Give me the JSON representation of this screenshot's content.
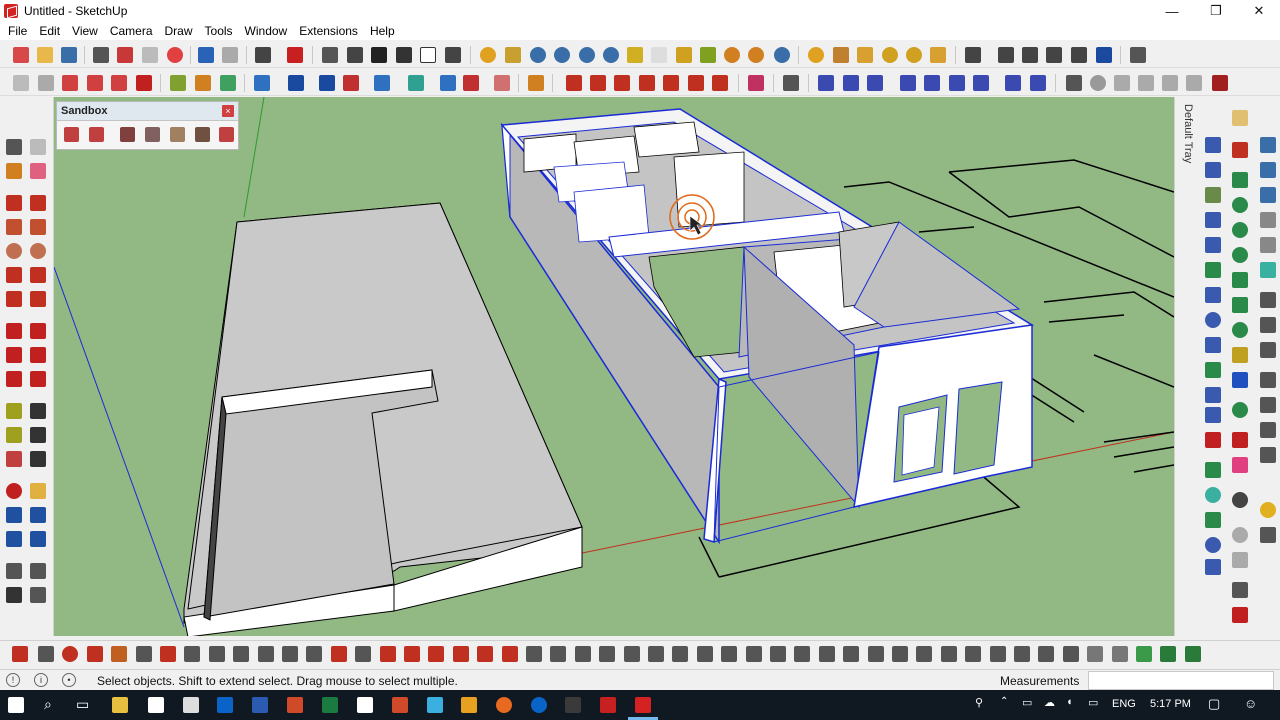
{
  "window": {
    "title": "Untitled - SketchUp",
    "controls": {
      "minimize": "—",
      "maximize": "❐",
      "close": "✕"
    }
  },
  "menu": [
    "File",
    "Edit",
    "View",
    "Camera",
    "Draw",
    "Tools",
    "Window",
    "Extensions",
    "Help"
  ],
  "sandbox_panel": {
    "title": "Sandbox",
    "close": "×"
  },
  "tray": {
    "label": "Default Tray"
  },
  "status": {
    "message": "Select objects. Shift to extend select. Drag mouse to select multiple.",
    "measurements_label": "Measurements",
    "measurements_value": ""
  },
  "taskbar": {
    "language": "ENG",
    "time": "5:17 PM"
  },
  "colors": {
    "viewport_bg": "#92b884",
    "selection": "#1a2bd6",
    "axis_red": "#c03020",
    "axis_green": "#2c9a2c",
    "axis_blue": "#1a2bd6",
    "cursor_ring": "#e06a1a"
  },
  "icons": {
    "status_left": [
      "info-circle-icon",
      "help-icon",
      "user-icon"
    ],
    "taskbar": [
      "start-icon",
      "search-icon",
      "task-view-icon",
      "file-explorer-icon",
      "store-icon",
      "calculator-icon",
      "outlook-icon",
      "word-icon",
      "powerpoint-icon",
      "excel-icon",
      "edge-icon",
      "settings-icon",
      "app-icon",
      "sketch-icon",
      "app2-icon",
      "firefox-icon",
      "xbox-icon",
      "acrobat-icon",
      "sketchup-taskbar-icon"
    ]
  }
}
